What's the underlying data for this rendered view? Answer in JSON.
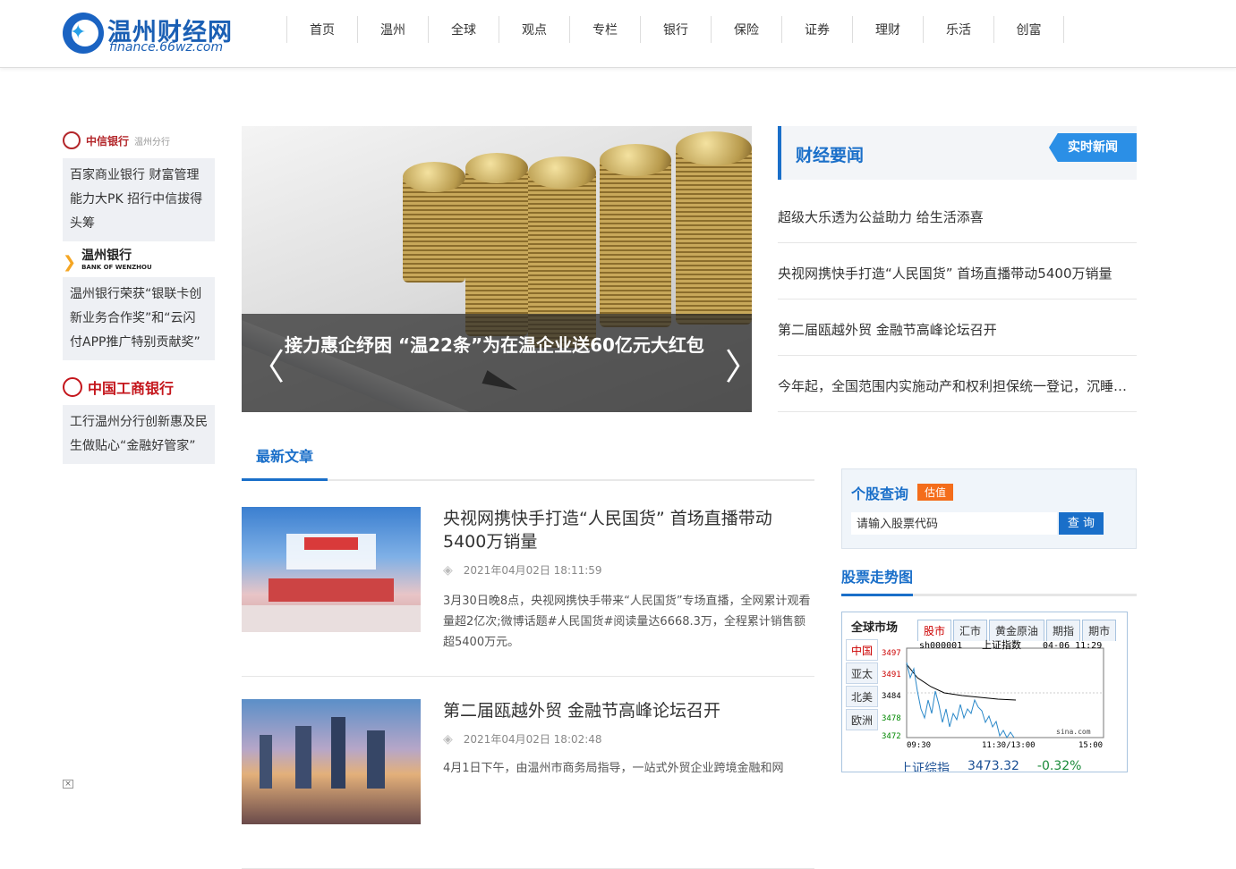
{
  "site": {
    "name": "温州财经网",
    "domain": "finance.66wz.com"
  },
  "nav": [
    "首页",
    "温州",
    "全球",
    "观点",
    "专栏",
    "银行",
    "保险",
    "证券",
    "理财",
    "乐活",
    "创富"
  ],
  "ads": [
    {
      "brand": "中信银行",
      "brand_sub": "温州分行",
      "text": "百家商业银行 财富管理能力大PK 招行中信拔得头筹"
    },
    {
      "brand": "温州银行",
      "brand_sub": "BANK OF WENZHOU",
      "text": "温州银行荣获“银联卡创新业务合作奖”和“云闪付APP推广特别贡献奖”"
    },
    {
      "brand": "中国工商银行",
      "brand_sub": "",
      "text": "工行温州分行创新惠及民生做贴心“金融好管家”"
    }
  ],
  "slider": {
    "caption": "接力惠企纾困 “温22条”为在温企业送60亿元大红包"
  },
  "news": {
    "title": "财经要闻",
    "tag": "实时新闻",
    "items": [
      "超级大乐透为公益助力 给生活添喜",
      "央视网携快手打造“人民国货” 首场直播带动5400万销量",
      "第二届瓯越外贸 金融节高峰论坛召开",
      "今年起，全国范围内实施动产和权利担保统一登记，沉睡资产将被唤醒"
    ]
  },
  "latest": {
    "tab": "最新文章",
    "articles": [
      {
        "title": "央视网携快手打造“人民国货” 首场直播带动5400万销量",
        "time": "2021年04月02日 18:11:59",
        "summary": "3月30日晚8点，央视网携快手带来“人民国货”专场直播，全网累计观看量超2亿次;微博话题#人民国货#阅读量达6668.3万，全程累计销售额超5400万元。"
      },
      {
        "title": "第二届瓯越外贸 金融节高峰论坛召开",
        "time": "2021年04月02日 18:02:48",
        "summary": "4月1日下午，由温州市商务局指导，一站式外贸企业跨境金融和网"
      }
    ]
  },
  "stock": {
    "title": "个股查询",
    "badge": "估值",
    "placeholder": "请输入股票代码",
    "button": "查 询"
  },
  "trend": {
    "title": "股票走势图"
  },
  "market": {
    "title": "全球市场",
    "tabs": [
      "股市",
      "汇市",
      "黄金原油",
      "期指",
      "期市"
    ],
    "regions": [
      "中国",
      "亚太",
      "北美",
      "欧洲"
    ],
    "code": "sh000001",
    "index_name": "上证指数",
    "datetime": "04-06 11:29",
    "y_ticks": [
      "3497",
      "3491",
      "3484",
      "3478",
      "3472"
    ],
    "x_ticks": [
      "09:30",
      "11:30/13:00",
      "15:00"
    ],
    "source": "sina.com",
    "ticker_name": "上证综指",
    "ticker_value": "3473.32",
    "ticker_change": "-0.32%"
  }
}
